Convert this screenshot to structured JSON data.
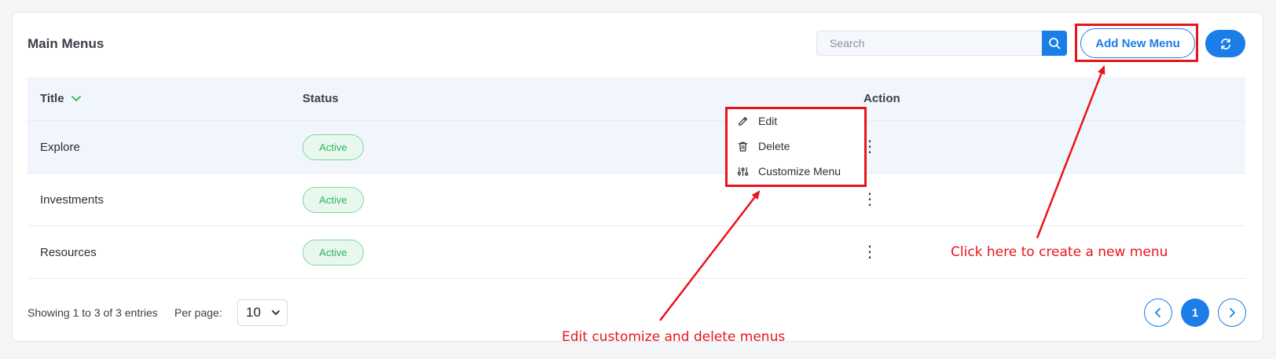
{
  "card": {
    "title": "Main Menus"
  },
  "search": {
    "placeholder": "Search",
    "value": ""
  },
  "toolbar": {
    "add_label": "Add New Menu"
  },
  "table": {
    "headers": {
      "title": "Title",
      "status": "Status",
      "action": "Action"
    },
    "rows": [
      {
        "title": "Explore",
        "status": "Active"
      },
      {
        "title": "Investments",
        "status": "Active"
      },
      {
        "title": "Resources",
        "status": "Active"
      }
    ]
  },
  "dropdown": {
    "items": [
      {
        "label": "Edit",
        "icon": "pencil-icon"
      },
      {
        "label": "Delete",
        "icon": "trash-icon"
      },
      {
        "label": "Customize Menu",
        "icon": "sliders-icon"
      }
    ]
  },
  "footer": {
    "showing": "Showing 1 to 3 of 3 entries",
    "per_page_label": "Per page:",
    "per_page_value": "10",
    "current_page": "1"
  },
  "annotations": {
    "add_hint": "Click here to create a new menu",
    "edit_hint": "Edit customize and delete menus"
  },
  "colors": {
    "primary": "#1a7de8",
    "active_badge_text": "#2fb45c",
    "active_badge_bg": "#e9f8ee",
    "annotation_red": "#e8141c"
  }
}
